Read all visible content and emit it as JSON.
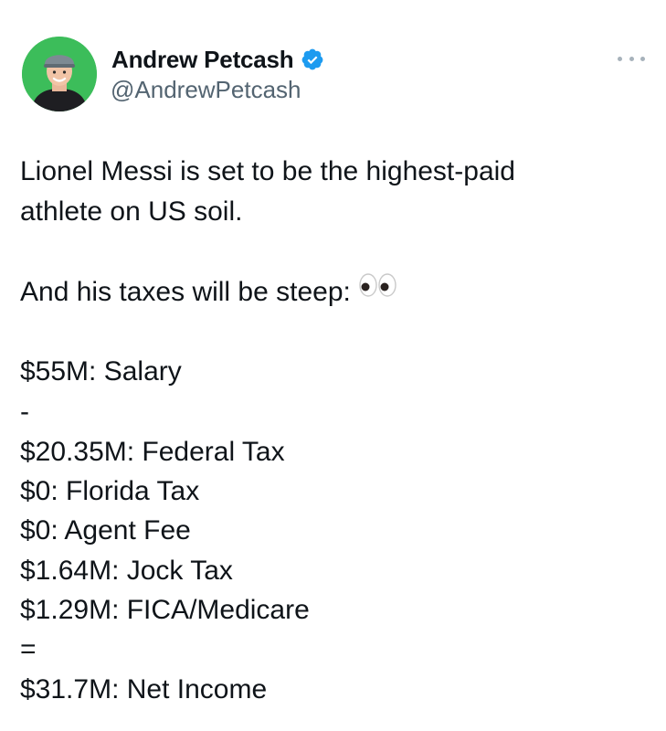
{
  "author": {
    "display_name": "Andrew Petcash",
    "handle": "@AndrewPetcash",
    "verified": true,
    "avatar_icon": "avatar-photo",
    "avatar_background": "#3cbd5a"
  },
  "menu": {
    "icon": "more-horizontal-icon"
  },
  "tweet": {
    "line1": "Lionel Messi is set to be the highest-paid",
    "line2": "athlete on US soil.",
    "line3": "And his taxes will be steep:",
    "line3_emoji": "eyes-emoji",
    "breakdown": [
      "$55M: Salary",
      "-",
      "$20.35M: Federal Tax",
      "$0: Florida Tax",
      "$0: Agent Fee",
      "$1.64M: Jock Tax",
      "$1.29M: FICA/Medicare",
      "=",
      "$31.7M: Net Income"
    ]
  },
  "colors": {
    "text_primary": "#0f1419",
    "text_secondary": "#536471",
    "verified_blue": "#1d9bf0"
  }
}
